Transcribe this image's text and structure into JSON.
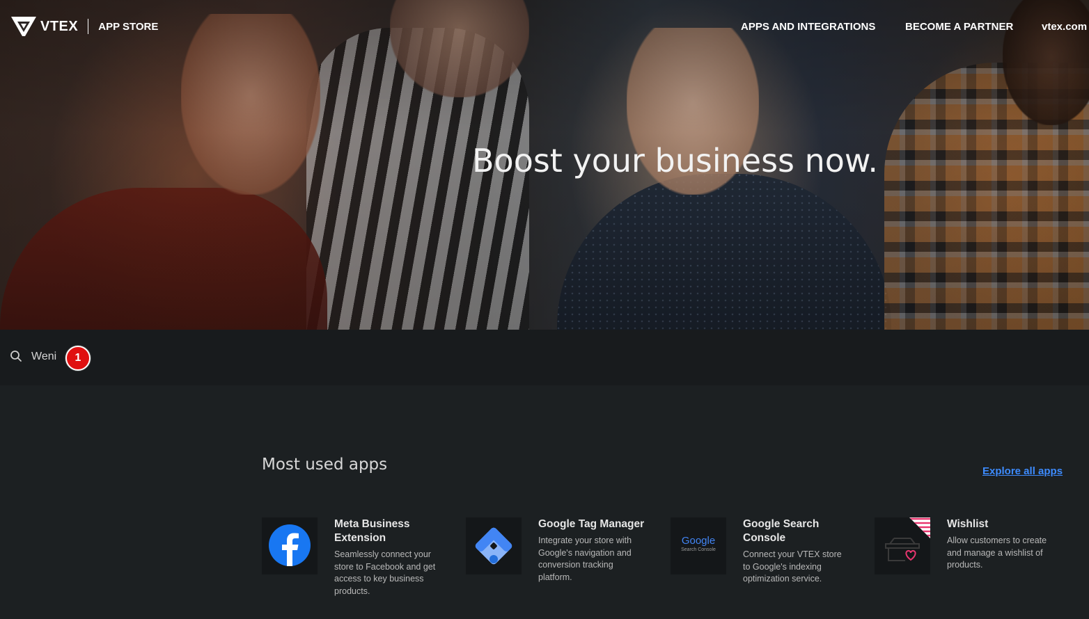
{
  "header": {
    "brand": "VTEX",
    "sub": "APP STORE",
    "nav": [
      "APPS AND INTEGRATIONS",
      "BECOME A PARTNER",
      "vtex.com"
    ]
  },
  "hero": {
    "title": "Boost your business now."
  },
  "search": {
    "value": "Weni",
    "badge": "1"
  },
  "main": {
    "section_title": "Most used apps",
    "explore_label": "Explore all apps",
    "apps": [
      {
        "title": "Meta Business Extension",
        "description": "Seamlessly connect your store to Facebook and get access to key business products.",
        "icon": "facebook-icon"
      },
      {
        "title": "Google Tag Manager",
        "description": "Integrate your store with Google's navigation and conversion tracking platform.",
        "icon": "google-tag-manager-icon"
      },
      {
        "title": "Google Search Console",
        "description": "Connect your VTEX store to Google's indexing optimization service.",
        "icon": "google-search-console-icon",
        "icon_text": "Google",
        "icon_subtext": "Search Console"
      },
      {
        "title": "Wishlist",
        "description": "Allow customers to create and manage a wishlist of products.",
        "icon": "wishlist-basket-icon"
      }
    ]
  },
  "colors": {
    "accent_link": "#3d8bff",
    "badge": "#e01010",
    "background": "#1c2022"
  }
}
